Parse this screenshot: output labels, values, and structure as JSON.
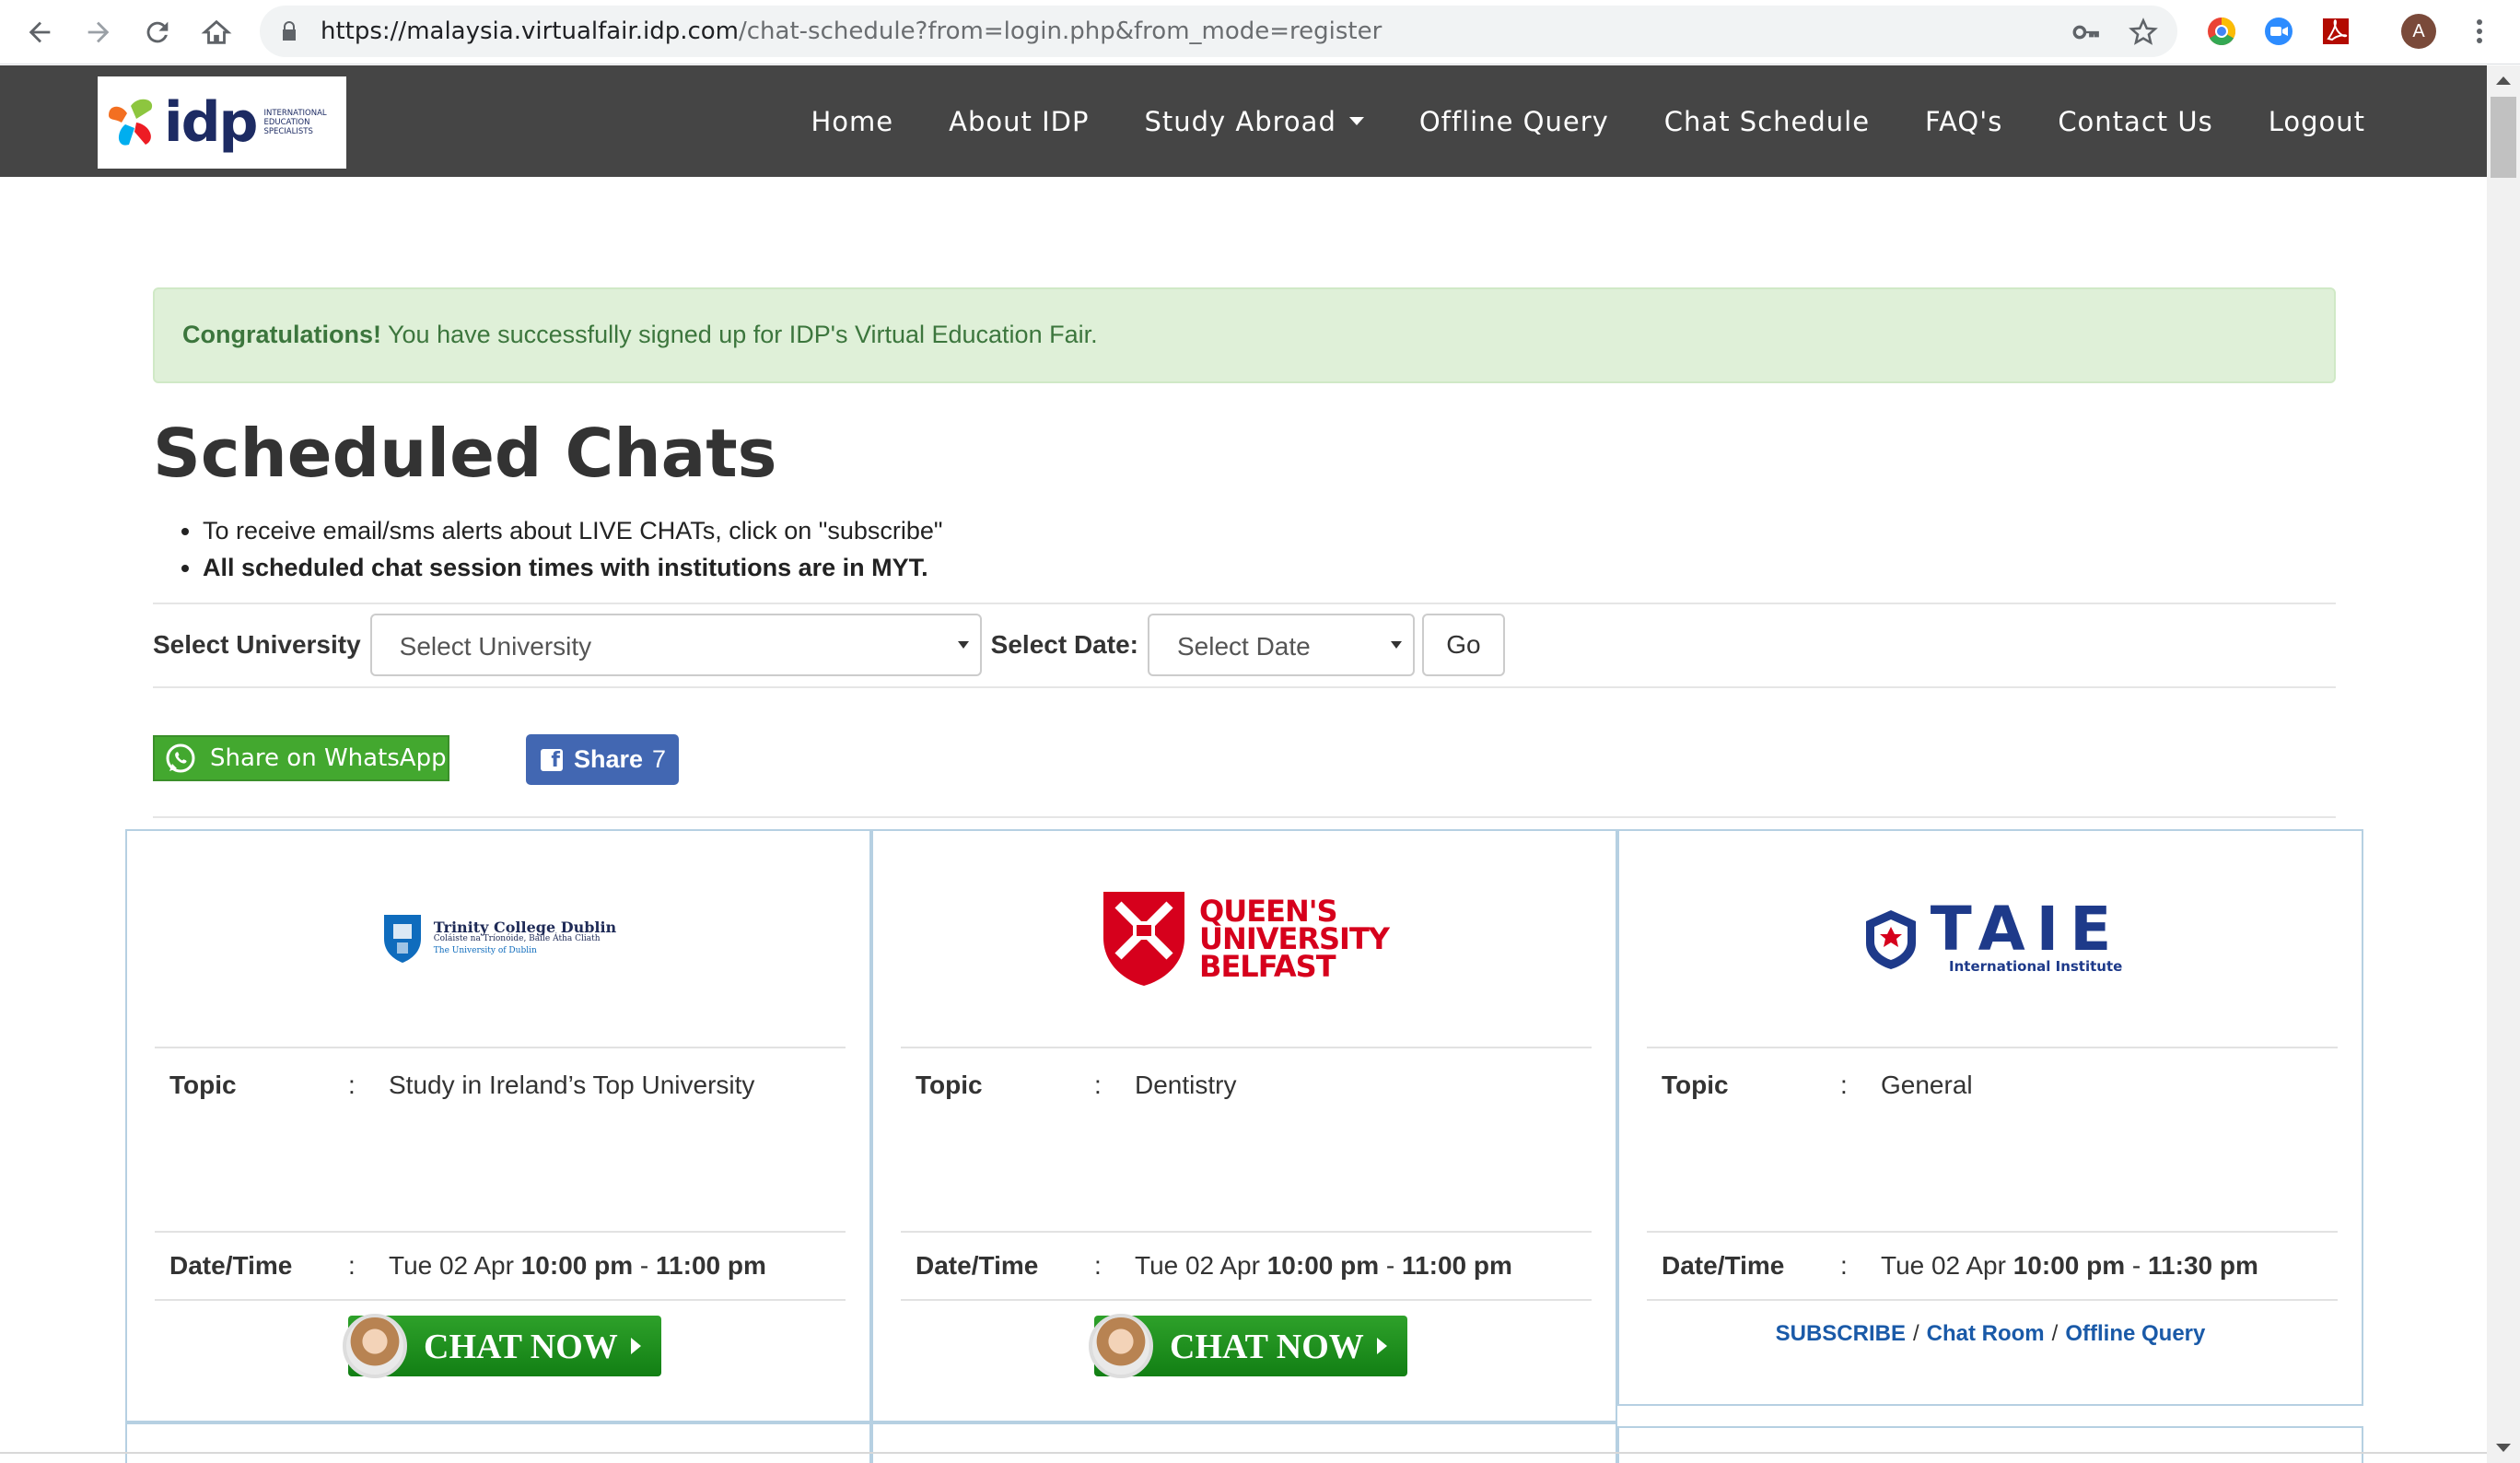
{
  "browser": {
    "url_host": "https://malaysia.virtualfair.idp.com",
    "url_path": "/chat-schedule?from=login.php&from_mode=register",
    "profile_initial": "A"
  },
  "navbar": {
    "logo_word": "idp",
    "logo_tagline": "International Education Specialists",
    "items": [
      {
        "label": "Home"
      },
      {
        "label": "About IDP"
      },
      {
        "label": "Study Abroad"
      },
      {
        "label": "Offline Query"
      },
      {
        "label": "Chat Schedule"
      },
      {
        "label": "FAQ's"
      },
      {
        "label": "Contact Us"
      },
      {
        "label": "Logout"
      }
    ]
  },
  "alert": {
    "strong": "Congratulations!",
    "text": " You have successfully signed up for IDP's Virtual Education Fair."
  },
  "page": {
    "title": "Scheduled Chats",
    "bullets": [
      "To receive email/sms alerts about LIVE CHATs, click on \"subscribe\"",
      "All scheduled chat session times with institutions are in MYT."
    ]
  },
  "filters": {
    "university_label": "Select University",
    "university_value": "Select University",
    "date_label": "Select Date:",
    "date_value": "Select Date",
    "go_label": "Go"
  },
  "share": {
    "whatsapp_label": "Share on WhatsApp",
    "facebook_label": "Share",
    "facebook_count": "7"
  },
  "cards": [
    {
      "institution": "Trinity College Dublin",
      "institution_sub1": "Coláiste na Tríonóide, Baile Átha Cliath",
      "institution_sub2": "The University of Dublin",
      "topic_label": "Topic",
      "topic": "Study in Ireland’s Top University",
      "datetime_label": "Date/Time",
      "date": "Tue 02 Apr",
      "start": "10:00 pm",
      "end": "11:00 pm",
      "action": "CHAT NOW"
    },
    {
      "institution_line1": "QUEEN'S",
      "institution_line2": "UNIVERSITY",
      "institution_line3": "BELFAST",
      "topic_label": "Topic",
      "topic": "Dentistry",
      "datetime_label": "Date/Time",
      "date": "Tue 02 Apr",
      "start": "10:00 pm",
      "end": "11:00 pm",
      "action": "CHAT NOW"
    },
    {
      "institution": "TAIE",
      "institution_sub1": "International Institute",
      "topic_label": "Topic",
      "topic": "General",
      "datetime_label": "Date/Time",
      "date": "Tue 02 Apr",
      "start": "10:00 pm",
      "end": "11:30 pm",
      "links": [
        "SUBSCRIBE",
        "Chat Room",
        "Offline Query"
      ]
    }
  ],
  "colors": {
    "navbar_bg": "#454545",
    "alert_bg": "#dff0d8",
    "alert_text": "#3c763d",
    "whatsapp_green": "#43a82f",
    "facebook_blue": "#4267b2",
    "link_blue": "#1a5aa8",
    "card_border": "#b6d0e2"
  }
}
